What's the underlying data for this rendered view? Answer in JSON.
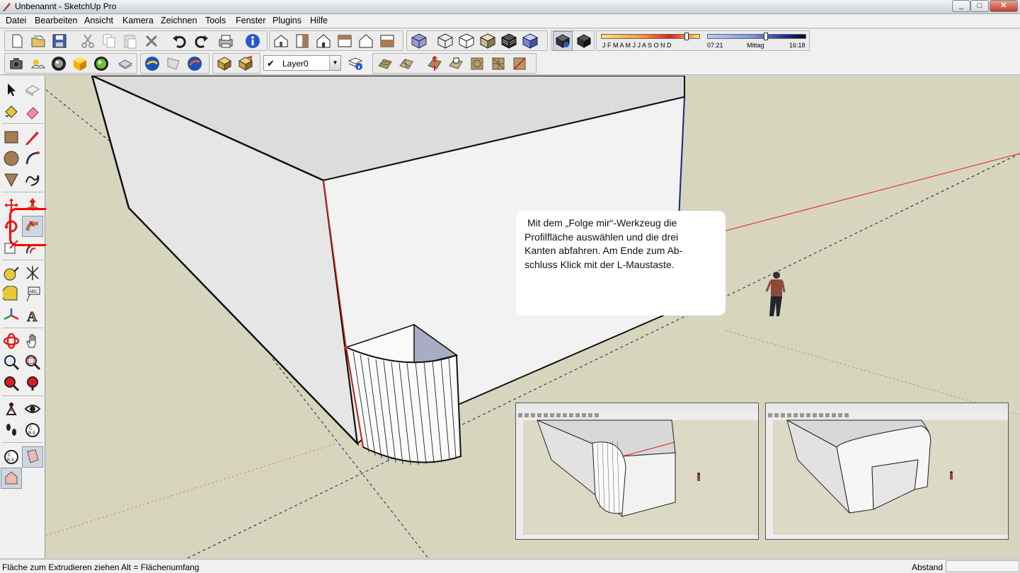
{
  "window": {
    "title": "Unbenannt - SketchUp Pro",
    "minimize": "_",
    "maximize": "□",
    "close": "✕"
  },
  "menu": [
    "Datei",
    "Bearbeiten",
    "Ansicht",
    "Kamera",
    "Zeichnen",
    "Tools",
    "Fenster",
    "Plugins",
    "Hilfe"
  ],
  "layer": {
    "check": "✔",
    "name": "Layer0"
  },
  "shadow": {
    "months": "J  F  M  A  M  J  J  A  S  O  N  D",
    "time_start": "07:21",
    "time_mid": "Mittag",
    "time_end": "16:18"
  },
  "callout": {
    "lines": [
      "Mit dem „Folge mir“-Werkzeug die",
      "Profilfläche auswählen und die drei",
      "Kanten abfahren. Am Ende zum Ab-",
      "schluss Klick mit der L-Maustaste."
    ]
  },
  "status": {
    "text": "Fläche zum Extrudieren ziehen  Alt = Flächenumfang",
    "measure_label": "Abstand",
    "measure_value": ""
  },
  "colors": {
    "accent_red": "#ff0000",
    "ground": "#d8d5bf",
    "face": "#f2f2f2",
    "face_top": "#dcdcdc",
    "face_blue": "#a9adc4"
  },
  "icons": {
    "toolbar1": [
      "new-icon",
      "open-icon",
      "save-icon",
      "cut-icon",
      "copy-icon",
      "paste-icon",
      "erase-icon",
      "undo-icon",
      "redo-icon",
      "print-icon",
      "model-info-icon",
      "iso-view-icon",
      "top-view-icon",
      "front-view-icon",
      "right-view-icon",
      "back-view-icon",
      "left-view-icon",
      "xray-icon",
      "wireframe-icon",
      "hidden-line-icon",
      "shaded-icon",
      "shaded-textures-icon",
      "monochrome-icon",
      "shadows-toggle-icon",
      "fog-icon"
    ],
    "toolbar2": [
      "camera-icon",
      "sun-icon",
      "sky-icon",
      "component-icon",
      "sphere-icon",
      "material-icon",
      "google-earth-icon",
      "photo-texture-icon",
      "warehouse-icon",
      "share-icon",
      "component-upload-icon",
      "layer-manager-icon",
      "sandbox-contour-icon",
      "sandbox-scratch-icon",
      "smoove-icon",
      "stamp-icon",
      "drape-icon",
      "add-detail-icon",
      "flip-edge-icon"
    ]
  }
}
